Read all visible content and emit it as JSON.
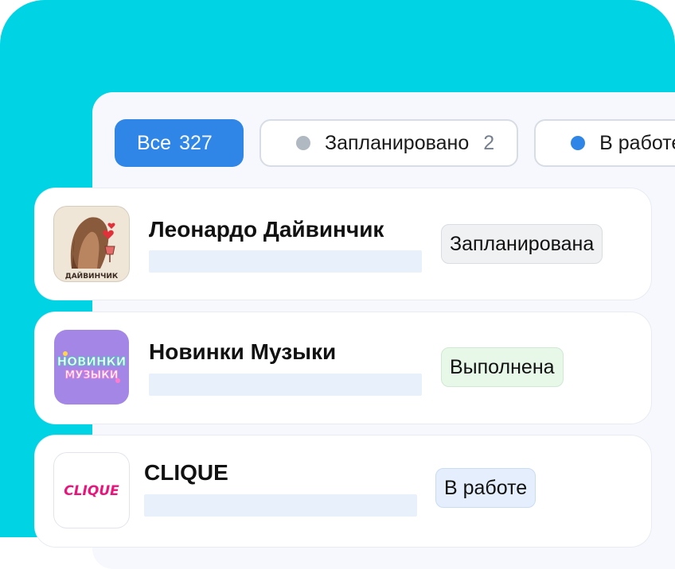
{
  "filters": [
    {
      "label": "Все",
      "count": "327",
      "active": true
    },
    {
      "label": "Запланировано",
      "count": "2",
      "dot": "#b0b8c2"
    },
    {
      "label": "В работе",
      "count": "",
      "dot": "#2f86e6"
    }
  ],
  "tasks": [
    {
      "name": "Леонардо Дайвинчик",
      "status": "Запланирована",
      "logo_text": "ДАЙВИНЧИК",
      "status_bg": "#f0f1f3",
      "status_border": "#d9dce1"
    },
    {
      "name": "Новинки Музыки",
      "status": "Выполнена",
      "logo_text_1": "НОВИНКИ",
      "logo_text_2": "МУЗЫКИ",
      "status_bg": "#e7f7e8",
      "status_border": "#cfe9d2"
    },
    {
      "name": "CLIQUE",
      "status": "В работе",
      "logo_text": "CLIQUE",
      "status_bg": "#e4eefc",
      "status_border": "#c9dcf6"
    }
  ]
}
